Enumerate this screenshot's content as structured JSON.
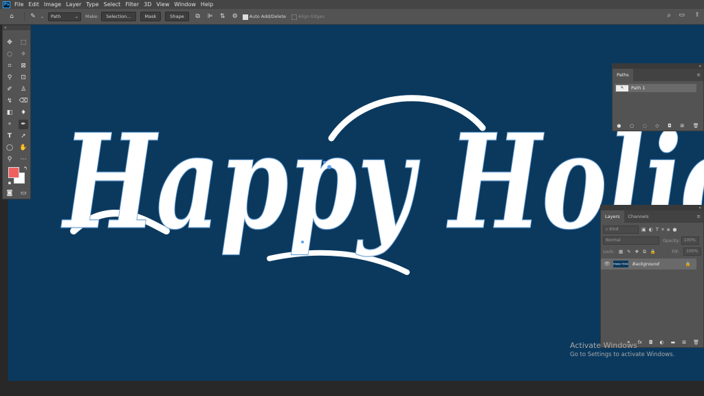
{
  "app": {
    "logo": "Ps"
  },
  "menubar": {
    "items": [
      "File",
      "Edit",
      "Image",
      "Layer",
      "Type",
      "Select",
      "Filter",
      "3D",
      "View",
      "Window",
      "Help"
    ]
  },
  "window_controls": {
    "minimize": "—",
    "maximize": "▢",
    "close": "✕"
  },
  "options_bar": {
    "mode_value": "Path",
    "make_label": "Make:",
    "selection_label": "Selection...",
    "mask_label": "Mask",
    "shape_label": "Shape",
    "auto_add_delete_label": "Auto Add/Delete",
    "auto_add_delete_checked": true,
    "align_edges_label": "Align Edges",
    "align_edges_checked": false
  },
  "toolbar": {
    "collapse": "«",
    "tools": [
      "move",
      "marquee",
      "lasso",
      "magic-wand",
      "crop",
      "frame",
      "eyedropper",
      "healing",
      "brush",
      "stamp",
      "history-brush",
      "eraser",
      "gradient",
      "blur",
      "dodge",
      "pen",
      "type",
      "path-selection",
      "ellipse",
      "hand",
      "zoom",
      "more",
      "foreground-color",
      "background-color",
      "quick-mask",
      "screen-mode"
    ],
    "foreground_color": "#f06060",
    "background_color": "#ffffff"
  },
  "canvas": {
    "background_color": "#0b395e",
    "text": "Happy Holid"
  },
  "paths_panel": {
    "tab_label": "Paths",
    "items": [
      {
        "name": "Path 1"
      }
    ]
  },
  "layers_panel": {
    "tabs": [
      "Layers",
      "Channels"
    ],
    "active_tab": "Layers",
    "filter_placeholder": "Kind",
    "blend_mode": "Normal",
    "opacity_label": "Opacity:",
    "opacity_value": "100%",
    "lock_label": "Lock:",
    "fill_label": "Fill:",
    "fill_value": "100%",
    "layers": [
      {
        "name": "Background",
        "thumb_text": "Happy Holiday",
        "visible": true,
        "locked": true
      }
    ]
  },
  "watermark": {
    "title": "Activate Windows",
    "subtitle": "Go to Settings to activate Windows."
  }
}
